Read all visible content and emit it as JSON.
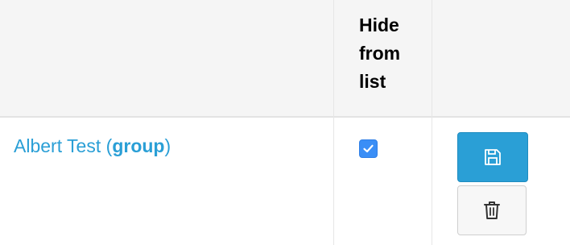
{
  "table": {
    "columns": [
      {
        "key": "name",
        "label": ""
      },
      {
        "key": "hide_from_list",
        "label": "Hide from list"
      },
      {
        "key": "actions",
        "label": ""
      }
    ],
    "header_hide_lines": [
      "Hide",
      "from",
      "list"
    ],
    "rows": [
      {
        "name": "Albert Test",
        "name_open": " (",
        "type": "group",
        "name_close": ")",
        "hide_from_list": true,
        "actions": {
          "save_icon": "floppy-disk-icon",
          "delete_icon": "trash-icon"
        }
      }
    ]
  },
  "colors": {
    "link": "#2a9fd6",
    "primary_button": "#2a9fd6",
    "checkbox": "#3a8ef6",
    "header_bg": "#f5f5f5"
  }
}
